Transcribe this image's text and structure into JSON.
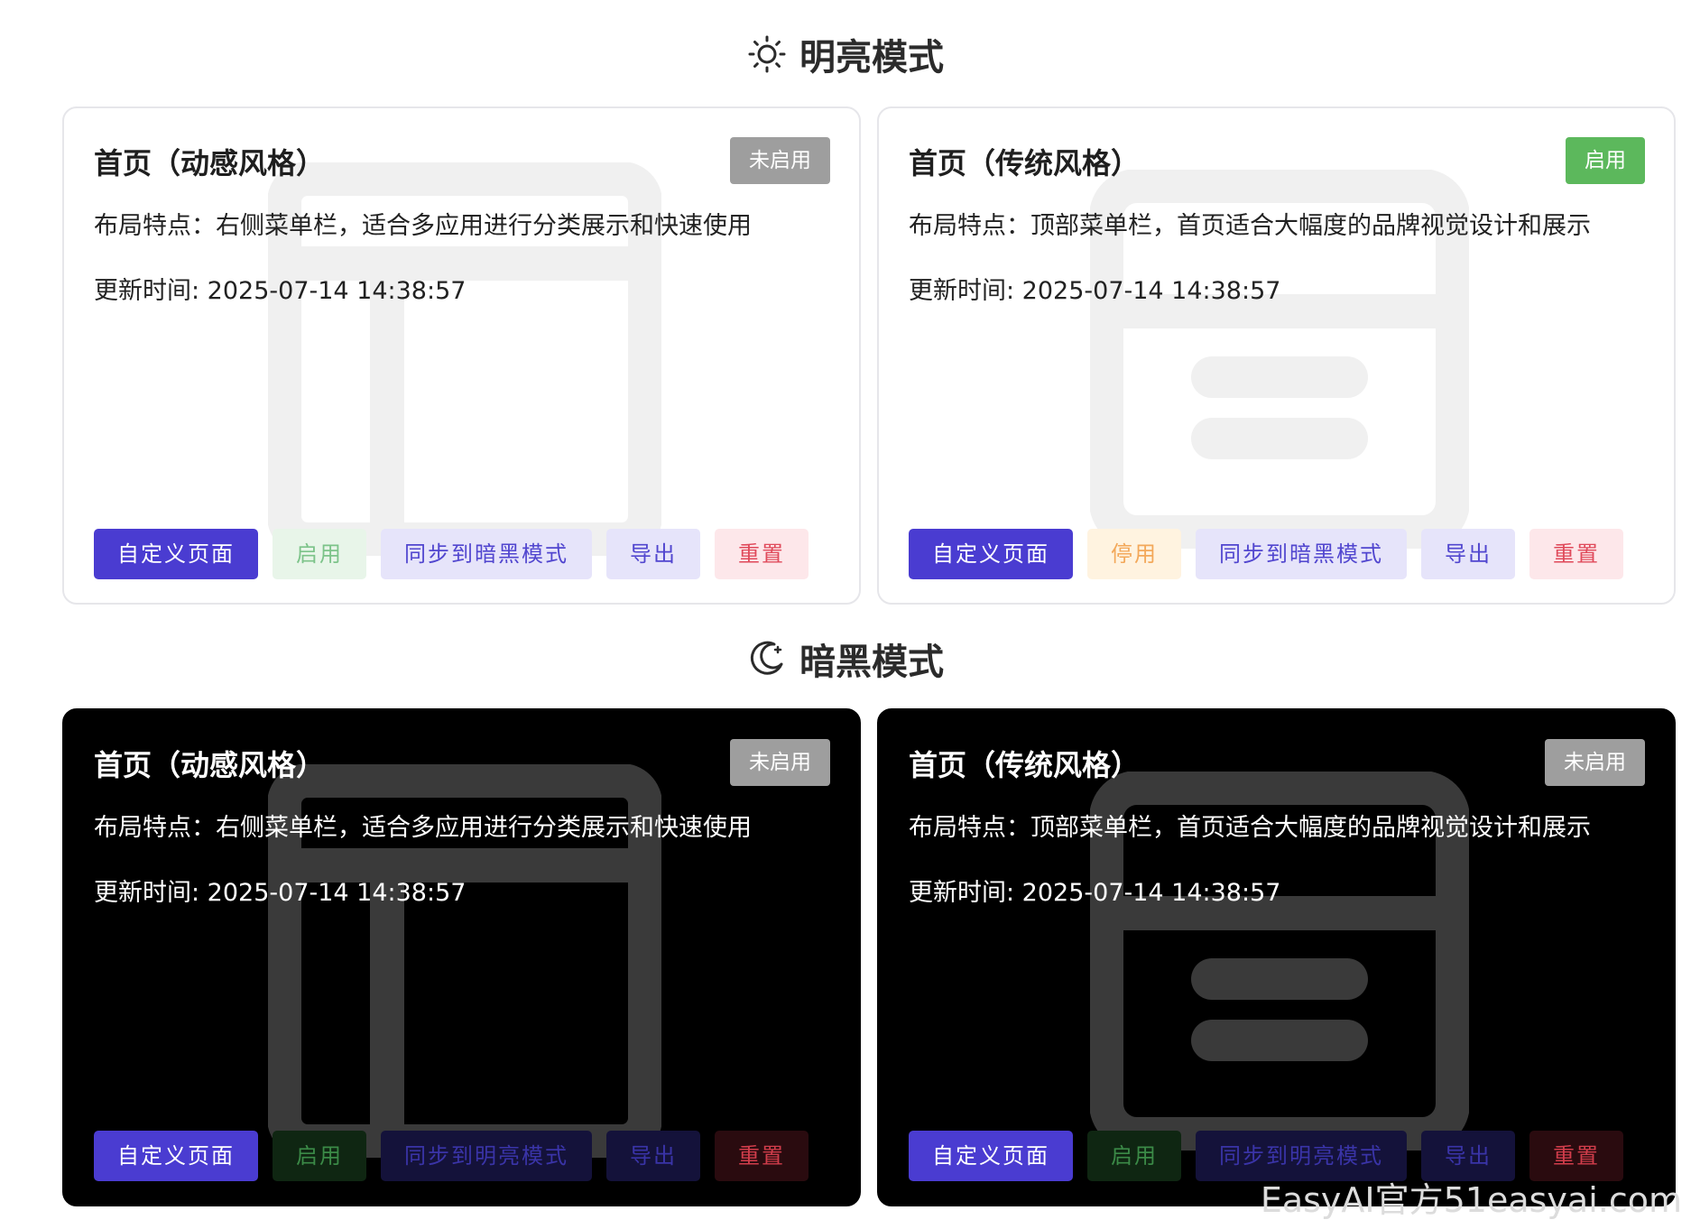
{
  "sections": {
    "light": {
      "title": "明亮模式",
      "icon": "sun-icon"
    },
    "dark": {
      "title": "暗黑模式",
      "icon": "moon-icon"
    }
  },
  "cards": {
    "light_dynamic": {
      "title": "首页（动感风格）",
      "status": "未启用",
      "desc": "布局特点：右侧菜单栏，适合多应用进行分类展示和快速使用",
      "updated": "更新时间: 2025-07-14 14:38:57",
      "buttons": [
        "自定义页面",
        "启用",
        "同步到暗黑模式",
        "导出",
        "重置"
      ]
    },
    "light_traditional": {
      "title": "首页（传统风格）",
      "status": "启用",
      "desc": "布局特点：顶部菜单栏，首页适合大幅度的品牌视觉设计和展示",
      "updated": "更新时间: 2025-07-14 14:38:57",
      "buttons": [
        "自定义页面",
        "停用",
        "同步到暗黑模式",
        "导出",
        "重置"
      ]
    },
    "dark_dynamic": {
      "title": "首页（动感风格）",
      "status": "未启用",
      "desc": "布局特点：右侧菜单栏，适合多应用进行分类展示和快速使用",
      "updated": "更新时间: 2025-07-14 14:38:57",
      "buttons": [
        "自定义页面",
        "启用",
        "同步到明亮模式",
        "导出",
        "重置"
      ]
    },
    "dark_traditional": {
      "title": "首页（传统风格）",
      "status": "未启用",
      "desc": "布局特点：顶部菜单栏，首页适合大幅度的品牌视觉设计和展示",
      "updated": "更新时间: 2025-07-14 14:38:57",
      "buttons": [
        "自定义页面",
        "启用",
        "同步到明亮模式",
        "导出",
        "重置"
      ]
    }
  },
  "colors": {
    "primary": "#4a3cd1",
    "enabled_badge": "#5cb85c",
    "disabled_badge": "#9e9e9e"
  },
  "footer_watermark": "EasyAI官方51easyai.com"
}
